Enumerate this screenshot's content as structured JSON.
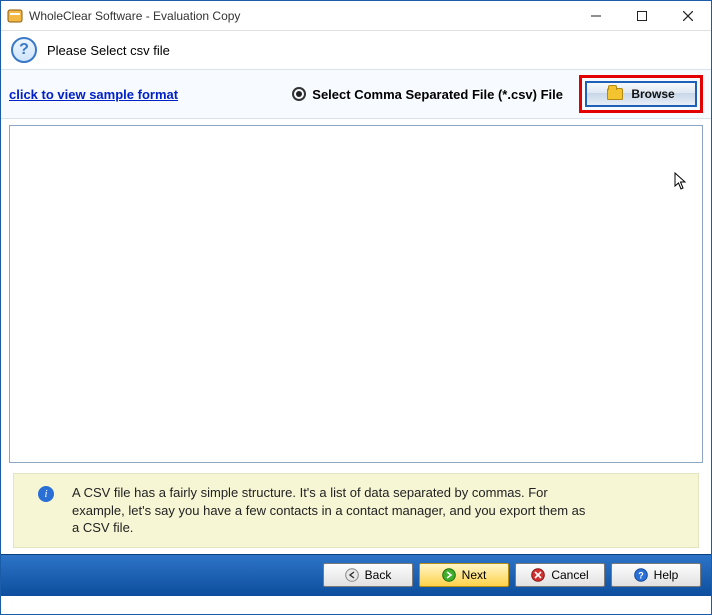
{
  "window": {
    "title": "WholeClear Software - Evaluation Copy"
  },
  "subtitle": "Please Select csv file",
  "controls": {
    "sample_link": "click to view sample format",
    "radio_label": "Select Comma Separated File (*.csv) File",
    "browse_label": "Browse"
  },
  "info": {
    "text": "A CSV file has a fairly simple structure. It's a list of data separated by commas. For example, let's say you have a few contacts in a contact manager, and you export them as a CSV file."
  },
  "footer": {
    "back": "Back",
    "next": "Next",
    "cancel": "Cancel",
    "help": "Help"
  }
}
